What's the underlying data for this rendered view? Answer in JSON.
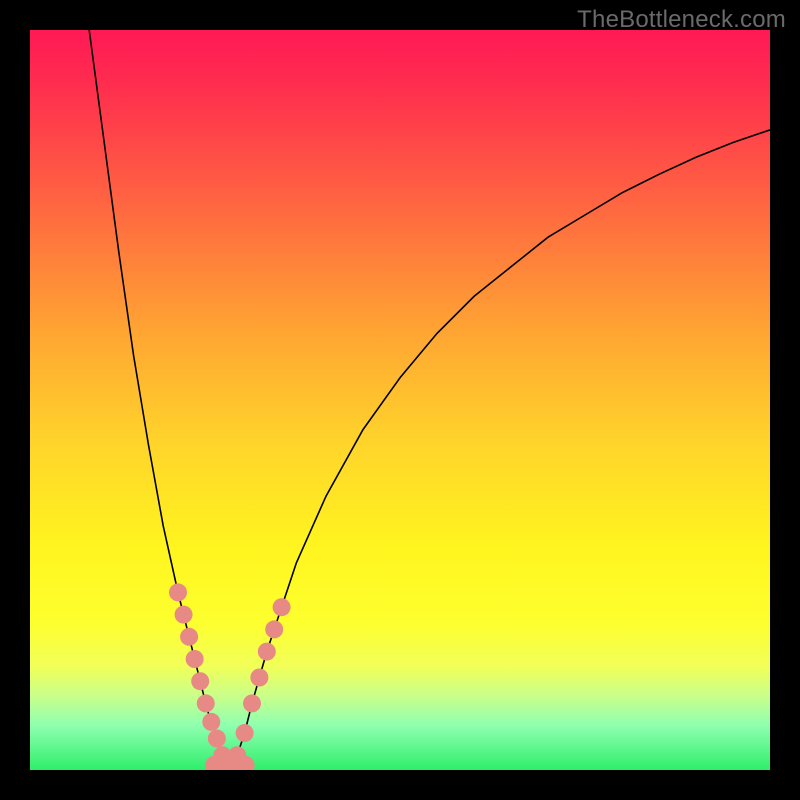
{
  "watermark": "TheBottleneck.com",
  "chart_data": {
    "type": "line",
    "title": "",
    "xlabel": "",
    "ylabel": "",
    "xlim": [
      0,
      100
    ],
    "ylim": [
      0,
      100
    ],
    "grid": false,
    "series": [
      {
        "name": "bottleneck-left-branch",
        "x": [
          8,
          10,
          12,
          14,
          16,
          18,
          20,
          21,
          22,
          23,
          24,
          25,
          26,
          27
        ],
        "values": [
          100,
          85,
          70,
          56,
          44,
          33,
          24,
          20,
          16,
          12,
          8,
          5,
          2,
          0
        ]
      },
      {
        "name": "bottleneck-right-branch",
        "x": [
          27,
          28,
          29,
          30,
          32,
          34,
          36,
          40,
          45,
          50,
          55,
          60,
          65,
          70,
          75,
          80,
          85,
          90,
          95,
          100
        ],
        "values": [
          0,
          2,
          5,
          9,
          16,
          22,
          28,
          37,
          46,
          53,
          59,
          64,
          68,
          72,
          75,
          78,
          80.5,
          82.8,
          84.8,
          86.5
        ]
      }
    ],
    "annotations": {
      "dot_clusters": [
        {
          "branch": "left",
          "x_range": [
            20,
            26
          ],
          "count": 9
        },
        {
          "branch": "right",
          "x_range": [
            28,
            34
          ],
          "count": 7
        },
        {
          "branch": "bottom",
          "x_range": [
            25,
            29
          ],
          "count": 5
        }
      ],
      "dot_color": "#e78a85"
    },
    "gradient_stops": [
      {
        "pos": 0.0,
        "color": "#ff1955"
      },
      {
        "pos": 0.4,
        "color": "#ffa233"
      },
      {
        "pos": 0.7,
        "color": "#fff51f"
      },
      {
        "pos": 1.0,
        "color": "#2fef6b"
      }
    ]
  }
}
